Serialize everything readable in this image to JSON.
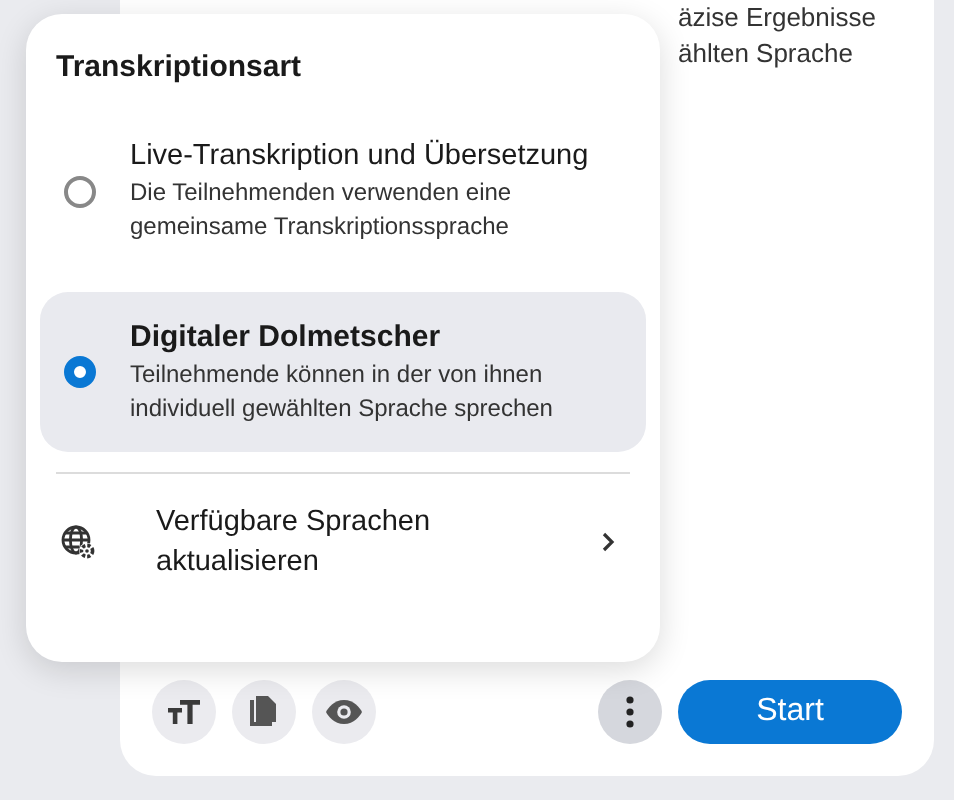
{
  "background_text": [
    "äzise Ergebnisse",
    "ählten Sprache"
  ],
  "popup": {
    "title": "Transkriptionsart",
    "options": [
      {
        "label": "Live-Transkription und Übersetzung",
        "description": "Die Teilnehmenden verwenden eine gemeinsame Transkriptionssprache",
        "selected": false
      },
      {
        "label": "Digitaler Dolmetscher",
        "description": "Teilnehmende können in der von ihnen individuell gewählten Sprache sprechen",
        "selected": true
      }
    ],
    "menu_item": {
      "label": "Verfügbare Sprachen aktualisieren"
    }
  },
  "toolbar": {
    "start_button": "Start"
  }
}
